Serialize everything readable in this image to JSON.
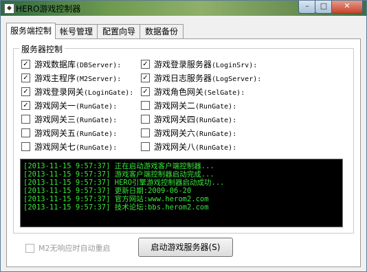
{
  "window": {
    "title": "HERO游戏控制器",
    "controls": {
      "minimize": "–",
      "maximize": "□",
      "close": "✕"
    }
  },
  "tabs": [
    {
      "label": "服务端控制",
      "active": true
    },
    {
      "label": "帐号管理",
      "active": false
    },
    {
      "label": "配置向导",
      "active": false
    },
    {
      "label": "数据备份",
      "active": false
    }
  ],
  "group": {
    "label": "服务器控制",
    "left_items": [
      {
        "label": "游戏数据库",
        "en": "(DBServer):",
        "checked": true
      },
      {
        "label": "游戏主程序",
        "en": "(M2Server):",
        "checked": true
      },
      {
        "label": "游戏登录网关",
        "en": "(LoginGate):",
        "checked": true
      },
      {
        "label": "游戏网关一",
        "en": "(RunGate):",
        "checked": true
      },
      {
        "label": "游戏网关三",
        "en": "(RunGate):",
        "checked": false
      },
      {
        "label": "游戏网关五",
        "en": "(RunGate):",
        "checked": false
      },
      {
        "label": "游戏网关七",
        "en": "(RunGate):",
        "checked": false
      }
    ],
    "right_items": [
      {
        "label": "游戏登录服务器",
        "en": "(LoginSrv):",
        "checked": true
      },
      {
        "label": "游戏日志服务器",
        "en": "(LogServer):",
        "checked": true
      },
      {
        "label": "游戏角色网关",
        "en": "(SelGate):",
        "checked": true
      },
      {
        "label": "游戏网关二",
        "en": "(RunGate):",
        "checked": false
      },
      {
        "label": "游戏网关四",
        "en": "(RunGate):",
        "checked": false
      },
      {
        "label": "游戏网关六",
        "en": "(RunGate):",
        "checked": false
      },
      {
        "label": "游戏网关八",
        "en": "(RunGate):",
        "checked": false
      }
    ]
  },
  "log": [
    "[2013-11-15 9:57:37] 正在启动游戏客户端控制器...",
    "[2013-11-15 9:57:37] 游戏客户端控制器启动完成...",
    "[2013-11-15 9:57:37] HERO引擎游戏控制器启动成功...",
    "[2013-11-15 9:57:37] 更新日期:2009-06-20",
    "[2013-11-15 9:57:37] 官方网站:www.herom2.com",
    "[2013-11-15 9:57:37] 技术论坛:bbs.herom2.com"
  ],
  "restart_option": {
    "label": "M2无响应时自动重启",
    "checked": false,
    "enabled": false
  },
  "start_button": {
    "label": "启动游戏服务器(S)"
  },
  "colors": {
    "log_text": "#38e83a",
    "log_bg": "#000000"
  }
}
